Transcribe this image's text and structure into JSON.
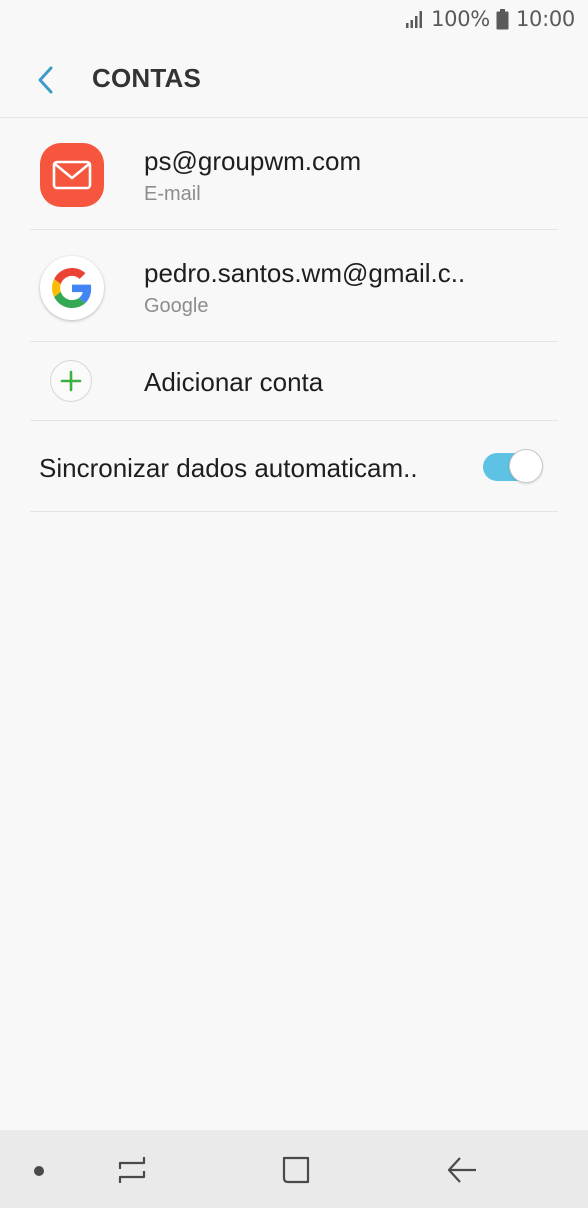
{
  "status_bar": {
    "battery": "100%",
    "time": "10:00",
    "icons": [
      "signal-icon",
      "battery-icon"
    ]
  },
  "header": {
    "back_icon": "chevron-left-icon",
    "title": "CONTAS"
  },
  "accounts": [
    {
      "name": "ps@groupwm.com",
      "type": "E-mail",
      "icon": "email-app-icon"
    },
    {
      "name": "pedro.santos.wm@gmail.c..",
      "type": "Google",
      "icon": "google-app-icon"
    }
  ],
  "add_account": {
    "label": "Adicionar conta",
    "icon": "plus-icon"
  },
  "sync": {
    "label": "Sincronizar dados automaticam..",
    "enabled": true
  },
  "nav_bar": {
    "icons": [
      "nav-dot-icon",
      "recent-apps-icon",
      "home-icon",
      "back-icon"
    ]
  },
  "colors": {
    "background": "#f8f8f8",
    "accent": "#3d9bc7",
    "email_icon": "#f5563d",
    "toggle_on": "#5ec2e5",
    "add_plus": "#3cb043",
    "nav_bar": "#eaeaea"
  }
}
